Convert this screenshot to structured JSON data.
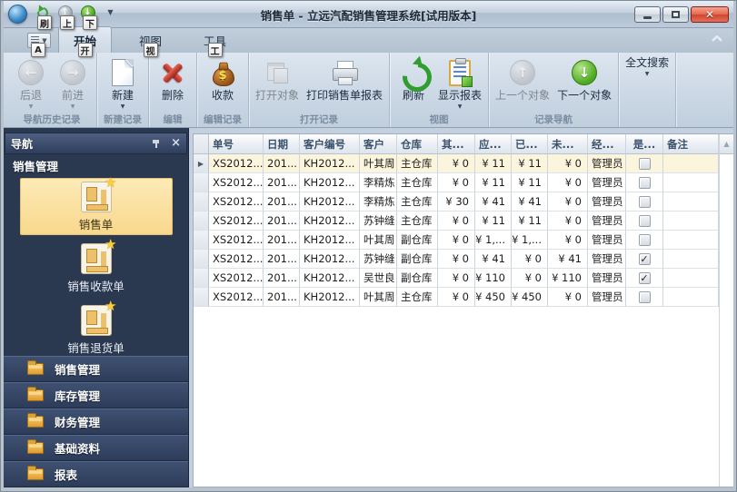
{
  "window": {
    "title": "销售单 - 立远汽配销售管理系统[试用版本]"
  },
  "quick_access": {
    "keytips": {
      "refresh": "刷",
      "previous": "上",
      "next": "下",
      "menu": "A"
    }
  },
  "ribbon": {
    "tabs": [
      {
        "label": "开始",
        "keytip": "开",
        "active": true
      },
      {
        "label": "视图",
        "keytip": "视",
        "active": false
      },
      {
        "label": "工具",
        "keytip": "工",
        "active": false
      }
    ],
    "groups": [
      {
        "label": "导航历史记录",
        "buttons": [
          {
            "label": "后退",
            "icon": "back-circle",
            "disabled": true,
            "dropdown": true
          },
          {
            "label": "前进",
            "icon": "forward-circle",
            "disabled": true,
            "dropdown": true
          }
        ]
      },
      {
        "label": "新建记录",
        "buttons": [
          {
            "label": "新建",
            "icon": "new-page",
            "disabled": false,
            "dropdown": true
          }
        ]
      },
      {
        "label": "编辑",
        "buttons": [
          {
            "label": "删除",
            "icon": "delete-x",
            "disabled": false,
            "dropdown": false
          }
        ]
      },
      {
        "label": "编辑记录",
        "buttons": [
          {
            "label": "收款",
            "icon": "money-bag",
            "disabled": false,
            "dropdown": false
          }
        ]
      },
      {
        "label": "打开记录",
        "buttons": [
          {
            "label": "打开对象",
            "icon": "open-object",
            "disabled": true,
            "dropdown": false
          },
          {
            "label": "打印销售单报表",
            "icon": "printer",
            "disabled": false,
            "dropdown": false
          }
        ]
      },
      {
        "label": "视图",
        "buttons": [
          {
            "label": "刷新",
            "icon": "refresh-arrow",
            "disabled": false,
            "dropdown": false
          },
          {
            "label": "显示报表",
            "icon": "report-clipboard",
            "disabled": false,
            "dropdown": true
          }
        ]
      },
      {
        "label": "记录导航",
        "buttons": [
          {
            "label": "上一个对象",
            "icon": "prev-circle",
            "disabled": true,
            "dropdown": false
          },
          {
            "label": "下一个对象",
            "icon": "next-circle",
            "disabled": false,
            "dropdown": false
          }
        ]
      },
      {
        "label": "",
        "buttons": [
          {
            "label": "全文搜索",
            "icon": null,
            "disabled": false,
            "dropdown": true
          }
        ]
      }
    ]
  },
  "nav": {
    "title": "导航",
    "section_header": "销售管理",
    "items": [
      {
        "label": "销售单",
        "selected": true
      },
      {
        "label": "销售收款单",
        "selected": false
      },
      {
        "label": "销售退货单",
        "selected": false,
        "clipped": true
      }
    ],
    "sections": [
      "销售管理",
      "库存管理",
      "财务管理",
      "基础资料",
      "报表"
    ]
  },
  "grid": {
    "columns": [
      "单号",
      "日期",
      "客户编号",
      "客户",
      "仓库",
      "其...",
      "应...",
      "已...",
      "未...",
      "经...",
      "是...",
      "备注"
    ],
    "sort_icon": "▲",
    "rows": [
      {
        "cells": [
          "XS2012...",
          "201...",
          "KH2012...",
          "叶其周",
          "主仓库",
          "¥ 0",
          "¥ 11",
          "¥ 11",
          "¥ 0",
          "管理员"
        ],
        "checked": false,
        "note": "",
        "selected": true
      },
      {
        "cells": [
          "XS2012...",
          "201...",
          "KH2012...",
          "李精炼",
          "主仓库",
          "¥ 0",
          "¥ 11",
          "¥ 11",
          "¥ 0",
          "管理员"
        ],
        "checked": false,
        "note": "",
        "selected": false
      },
      {
        "cells": [
          "XS2012...",
          "201...",
          "KH2012...",
          "李精炼",
          "主仓库",
          "¥ 30",
          "¥ 41",
          "¥ 41",
          "¥ 0",
          "管理员"
        ],
        "checked": false,
        "note": "",
        "selected": false
      },
      {
        "cells": [
          "XS2012...",
          "201...",
          "KH2012...",
          "苏钟缝",
          "主仓库",
          "¥ 0",
          "¥ 11",
          "¥ 11",
          "¥ 0",
          "管理员"
        ],
        "checked": false,
        "note": "",
        "selected": false
      },
      {
        "cells": [
          "XS2012...",
          "201...",
          "KH2012...",
          "叶其周",
          "副仓库",
          "¥ 0",
          "¥ 1,...",
          "¥ 1,...",
          "¥ 0",
          "管理员"
        ],
        "checked": false,
        "note": "",
        "selected": false
      },
      {
        "cells": [
          "XS2012...",
          "201...",
          "KH2012...",
          "苏钟缝",
          "副仓库",
          "¥ 0",
          "¥ 41",
          "¥ 0",
          "¥ 41",
          "管理员"
        ],
        "checked": true,
        "note": "",
        "selected": false
      },
      {
        "cells": [
          "XS2012...",
          "201...",
          "KH2012...",
          "吴世良",
          "副仓库",
          "¥ 0",
          "¥ 110",
          "¥ 0",
          "¥ 110",
          "管理员"
        ],
        "checked": true,
        "note": "",
        "selected": false
      },
      {
        "cells": [
          "XS2012...",
          "201...",
          "KH2012...",
          "叶其周",
          "主仓库",
          "¥ 0",
          "¥ 450",
          "¥ 450",
          "¥ 0",
          "管理员"
        ],
        "checked": false,
        "note": "",
        "selected": false
      }
    ]
  }
}
